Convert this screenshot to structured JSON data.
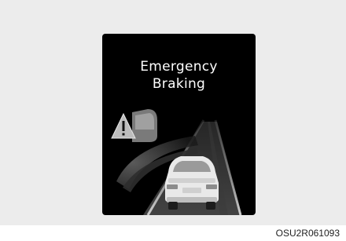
{
  "display": {
    "message_line1": "Emergency",
    "message_line2": "Braking",
    "warning_icon": "warning-triangle-icon",
    "vehicle_icon": "ego-vehicle-rear-icon",
    "background_color": "#000000"
  },
  "figure": {
    "caption": "OSU2R061093"
  }
}
